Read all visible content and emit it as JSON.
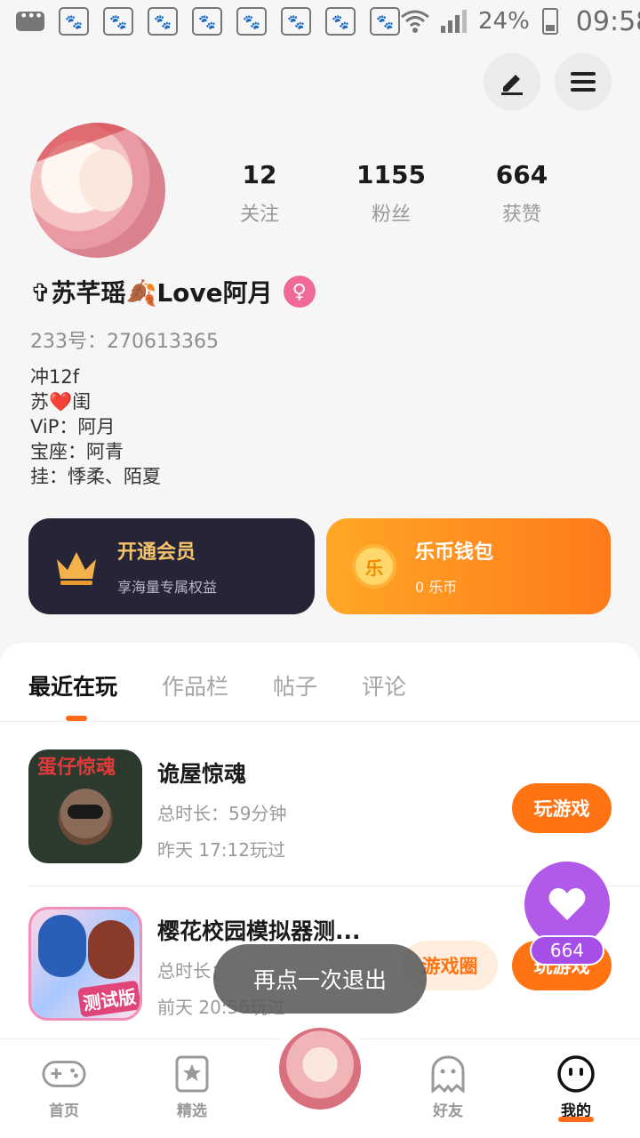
{
  "status_bar": {
    "battery": "24%",
    "time": "09:58",
    "notification_count": 8
  },
  "profile": {
    "stats": [
      {
        "value": "12",
        "label": "关注"
      },
      {
        "value": "1155",
        "label": "粉丝"
      },
      {
        "value": "664",
        "label": "获赞"
      }
    ],
    "nickname": "✞苏芊瑶🍂Love阿月",
    "gender_icon": "♀",
    "uid": "233号：270613365",
    "bio": [
      "冲12f",
      "苏❤️闺",
      "ViP：阿月",
      "宝座：阿青",
      "挂：悸柔、陌夏"
    ]
  },
  "cards": {
    "vip": {
      "title": "开通会员",
      "subtitle": "享海量专属权益"
    },
    "wallet": {
      "title": "乐币钱包",
      "subtitle": "0 乐币",
      "coin_glyph": "乐"
    }
  },
  "tabs": [
    "最近在玩",
    "作品栏",
    "帖子",
    "评论"
  ],
  "games": [
    {
      "icon_text": "蛋仔惊魂",
      "title": "诡屋惊魂",
      "duration": "总时长：59分钟",
      "last_played": "昨天 17:12玩过",
      "play_label": "玩游戏"
    },
    {
      "icon_text": "测试版",
      "title": "樱花校园模拟器测...",
      "duration": "总时长：",
      "last_played": "前天 20:56玩过",
      "circle_label": "游戏圈",
      "play_label": "玩游戏"
    }
  ],
  "fab": {
    "count": "664"
  },
  "toast": "再点一次退出",
  "bottom_nav": {
    "home": "首页",
    "featured": "精选",
    "friends": "好友",
    "mine": "我的"
  },
  "colors": {
    "accent": "#ff7313",
    "fab": "#b159e8",
    "vip_card": "#262538"
  }
}
